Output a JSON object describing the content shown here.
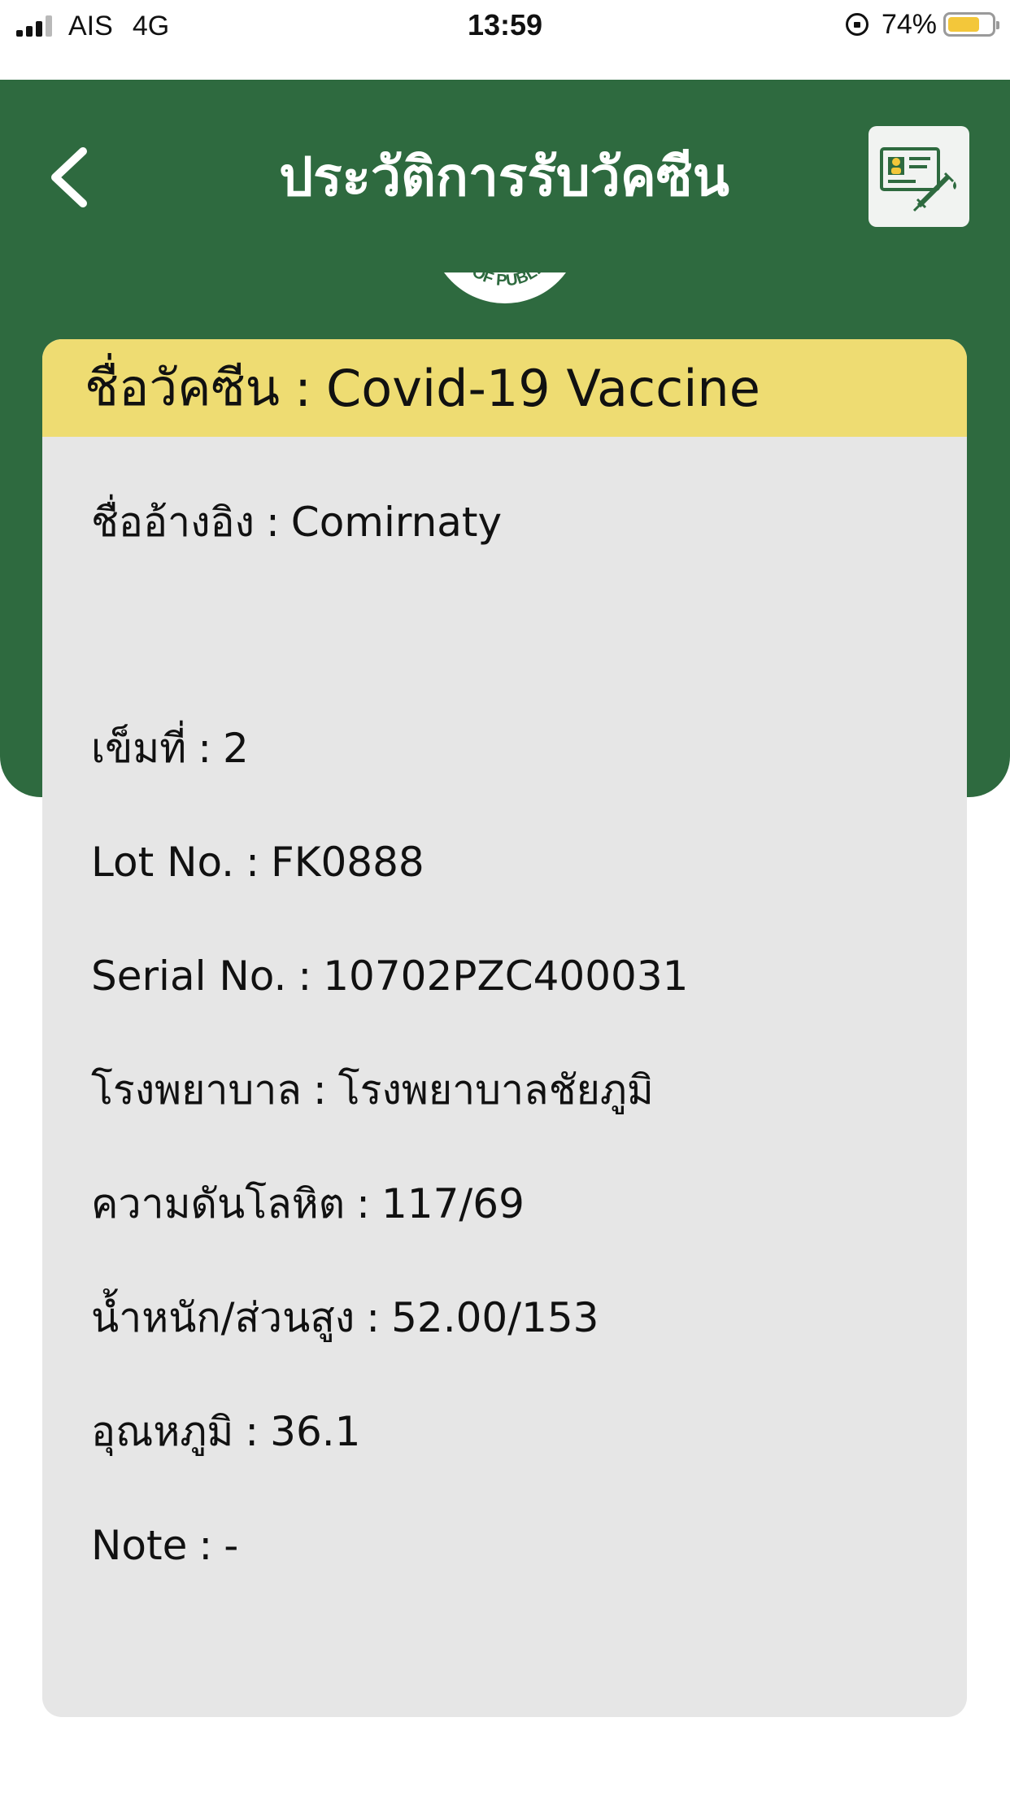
{
  "status_bar": {
    "carrier": "AIS",
    "network": "4G",
    "time": "13:59",
    "battery_text": "74%",
    "battery_level": 0.74,
    "signal_bars": 3
  },
  "header": {
    "title": "ประวัติการรับวัคซีน",
    "back_icon": "chevron-left-icon",
    "card_icon": "vaccine-card-icon",
    "logo_text": "Y OF PUBLIC"
  },
  "card": {
    "header_label": "ชื่อวัคซีน",
    "header_value": "Covid-19 Vaccine",
    "separator": ":",
    "rows": [
      {
        "label": "ชื่ออ้างอิง",
        "value": "Comirnaty"
      },
      {
        "label": "เข็มที่",
        "value": "2"
      },
      {
        "label": "Lot No.",
        "value": "FK0888"
      },
      {
        "label": "Serial No.",
        "value": "10702PZC400031"
      },
      {
        "label": "โรงพยาบาล",
        "value": "โรงพยาบาลชัยภูมิ"
      },
      {
        "label": "ความดันโลหิต",
        "value": "117/69"
      },
      {
        "label": "น้ำหนัก/ส่วนสูง",
        "value": "52.00/153"
      },
      {
        "label": "อุณหภูมิ",
        "value": "36.1"
      },
      {
        "label": "Note",
        "value": "-"
      }
    ]
  },
  "colors": {
    "header_green": "#2e6a3f",
    "card_yellow": "#eedc72",
    "card_gray": "#e6e6e6",
    "battery_yellow": "#f3c73a"
  }
}
